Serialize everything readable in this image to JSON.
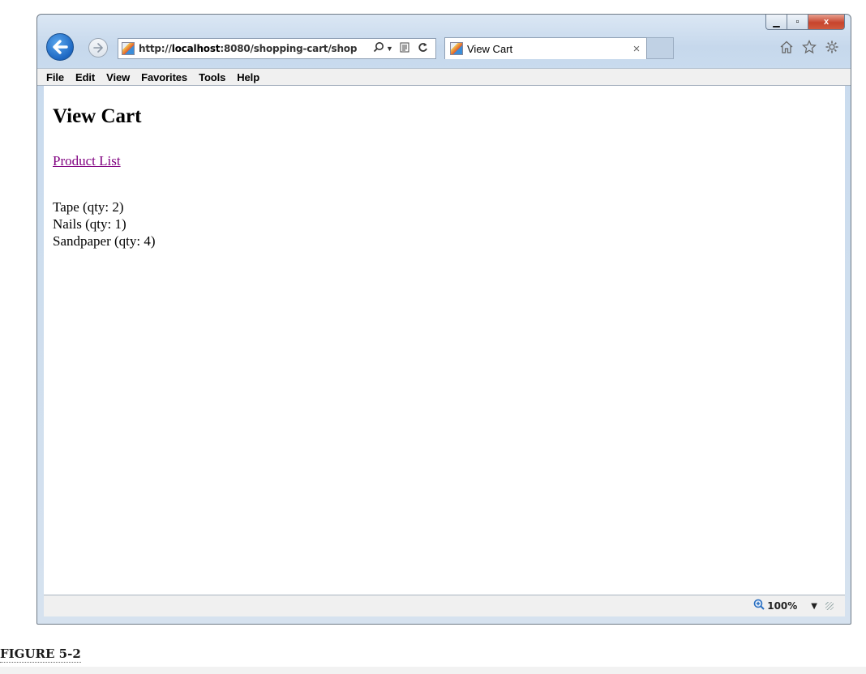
{
  "browser": {
    "address_url_prefix": "http://",
    "address_url_host": "localhost",
    "address_url_rest": ":8080/shopping-cart/shop",
    "tab_title": "View Cart",
    "tab_close": "×",
    "icons": {
      "back": "back-arrow-icon",
      "forward": "forward-arrow-icon",
      "search": "search-icon",
      "compat": "compatibility-view-icon",
      "refresh": "refresh-icon",
      "home": "home-icon",
      "favorites": "star-icon",
      "tools": "gear-icon"
    },
    "window_controls": {
      "minimize": "▁",
      "maximize": "▫",
      "close": "x"
    }
  },
  "menubar": {
    "items": [
      "File",
      "Edit",
      "View",
      "Favorites",
      "Tools",
      "Help"
    ]
  },
  "page": {
    "title": "View Cart",
    "link_label": "Product List",
    "cart_items": [
      {
        "name": "Tape",
        "label": "Tape (qty: 2)",
        "qty": 2
      },
      {
        "name": "Nails",
        "label": "Nails (qty: 1)",
        "qty": 1
      },
      {
        "name": "Sandpaper",
        "label": "Sandpaper (qty: 4)",
        "qty": 4
      }
    ],
    "link_color": "#800080"
  },
  "statusbar": {
    "zoom_level": "100%"
  },
  "caption": "FIGURE 5-2"
}
